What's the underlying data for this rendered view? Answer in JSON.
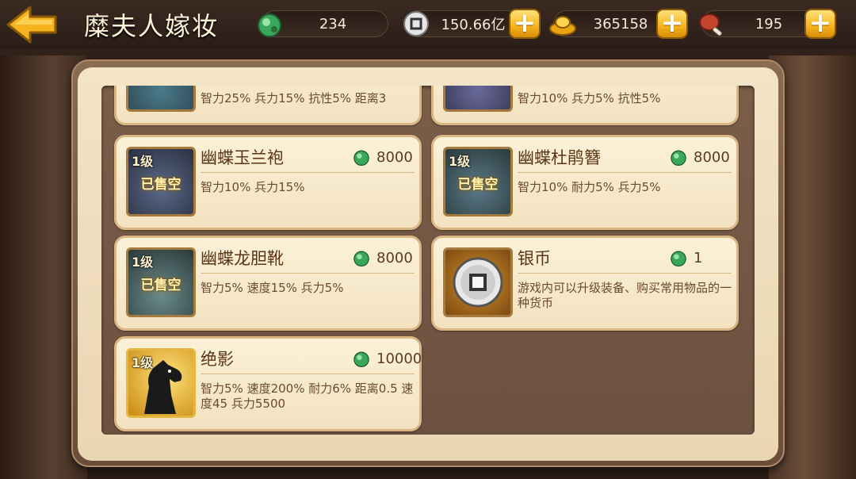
{
  "header": {
    "title": "糜夫人嫁妆",
    "resources": [
      {
        "icon": "jade-icon",
        "value": "234"
      },
      {
        "icon": "silver-coin-icon",
        "value": "150.66亿"
      },
      {
        "icon": "gold-ingot-icon",
        "value": "365158"
      },
      {
        "icon": "meat-icon",
        "value": "195"
      }
    ]
  },
  "items": [
    {
      "name": "",
      "level": "",
      "price": "",
      "desc": "智力25%  兵力15%  抗性5%  距离3",
      "sold": false
    },
    {
      "name": "",
      "level": "",
      "price": "",
      "desc": "智力10%  兵力5%  抗性5%",
      "sold": false
    },
    {
      "name": "幽蝶玉兰袍",
      "level": "1级",
      "price": "8000",
      "desc": "智力10%  兵力15%",
      "sold": true,
      "sold_label": "已售空"
    },
    {
      "name": "幽蝶杜鹃簪",
      "level": "1级",
      "price": "8000",
      "desc": "智力10%  耐力5%  兵力5%",
      "sold": true,
      "sold_label": "已售空"
    },
    {
      "name": "幽蝶龙胆靴",
      "level": "1级",
      "price": "8000",
      "desc": "智力5%  速度15%  兵力5%",
      "sold": true,
      "sold_label": "已售空"
    },
    {
      "name": "银币",
      "level": "",
      "price": "1",
      "desc": "游戏内可以升级装备、购买常用物品的一种货币",
      "sold": false
    },
    {
      "name": "绝影",
      "level": "1级",
      "price": "10000",
      "desc": "智力5%  速度200%  耐力6%  距离0.5  速度45  兵力5500",
      "sold": false
    }
  ],
  "colors": {
    "accent": "#f6b31d",
    "card_bg": "#fbf1d8",
    "panel_bg": "#6d5140",
    "title_text": "#fff3d8"
  }
}
